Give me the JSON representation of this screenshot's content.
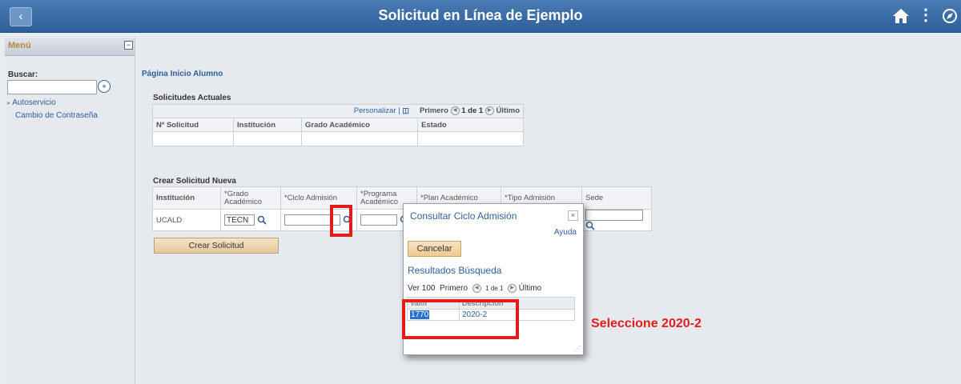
{
  "header": {
    "title": "Solicitud en Línea de Ejemplo",
    "back_icon": "chevron-left-icon",
    "home_icon": "home-icon",
    "actions_icon": "vertical-dots-icon",
    "navbar_icon": "compass-icon"
  },
  "sidebar": {
    "menu_title": "Menú",
    "collapse_icon": "minus-box-icon",
    "search_label": "Buscar:",
    "search_value": "",
    "go_icon": "double-chevron-right-icon",
    "items": [
      {
        "label": "Autoservicio",
        "expandable": true
      },
      {
        "label": "Cambio de Contraseña",
        "expandable": false
      }
    ]
  },
  "main": {
    "page_link": "Página Inicio Alumno",
    "current_requests": {
      "title": "Solicitudes Actuales",
      "toolbar": {
        "personalize": "Personalizar |",
        "first": "Primero",
        "range": "1 de 1",
        "last": "Último"
      },
      "columns": [
        "Nº Solicitud",
        "Institución",
        "Grado Académico",
        "Estado"
      ],
      "rows": []
    },
    "new_request": {
      "title": "Crear Solicitud Nueva",
      "columns": [
        "Institución",
        "*Grado Académico",
        "*Ciclo Admisión",
        "*Programa Académico",
        "*Plan Académico",
        "*Tipo Admisión",
        "Sede"
      ],
      "row": {
        "institution": "UCALD",
        "grado": "TECN",
        "ciclo": "",
        "programa": "",
        "plan": "",
        "tipo": "",
        "sede": ""
      },
      "create_button": "Crear Solicitud"
    }
  },
  "modal": {
    "title": "Consultar Ciclo Admisión",
    "close": "×",
    "help": "Ayuda",
    "cancel": "Cancelar",
    "results_title": "Resultados Búsqueda",
    "pager": {
      "view": "Ver 100",
      "first": "Primero",
      "range": "1 de 1",
      "last": "Último"
    },
    "columns": [
      "Valor",
      "Descripción"
    ],
    "results": [
      {
        "code": "1770",
        "description": "2020-2"
      }
    ]
  },
  "annotation": "Seleccione 2020-2",
  "colors": {
    "header_blue": "#2f5f9a",
    "highlight_red": "#e21b1b",
    "button_tan": "#e5c99b"
  }
}
